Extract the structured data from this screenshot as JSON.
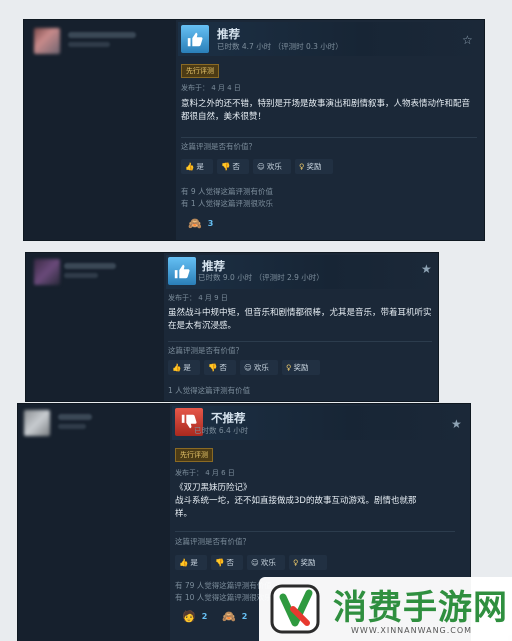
{
  "colors": {
    "card_bg": "#1b2838",
    "accent_blue": "#66c0f4",
    "recommend_icon": "#1a9fff",
    "not_recommend_icon": "#c8372b",
    "early_access_tag": "#e8c66a",
    "watermark_green": "#2f8f3f"
  },
  "reviews": [
    {
      "verdict": "推荐",
      "hours": "已时数 4.7 小时 （评测时 0.3 小时）",
      "tag": "先行评测",
      "date": "发布于： 4 月 4 日",
      "body": "意料之外的还不错，特别是开场是故事演出和剧情叙事，人物表情动作和配音都很自然，美术很赞！",
      "helpful_question": "这篇评测是否有价值？",
      "buttons": {
        "yes": "是",
        "no": "否",
        "funny": "欢乐",
        "award": "奖励"
      },
      "stats": [
        "有 9 人觉得这篇评测有价值",
        "有 1 人觉得这篇评测很欢乐"
      ],
      "award_count": "3"
    },
    {
      "verdict": "推荐",
      "hours": "已时数 9.0 小时 （评测时 2.9 小时）",
      "date": "发布于： 4 月 9 日",
      "body": "虽然战斗中规中矩，但音乐和剧情都很棒，尤其是音乐，带着耳机听实在是太有沉浸感。",
      "helpful_question": "这篇评测是否有价值？",
      "buttons": {
        "yes": "是",
        "no": "否",
        "funny": "欢乐",
        "award": "奖励"
      },
      "stats": [
        "1 人觉得这篇评测有价值"
      ]
    },
    {
      "verdict": "不推荐",
      "hours": "已时数 6.4 小时",
      "tag": "先行评测",
      "date": "发布于： 4 月 6 日",
      "body_title": "《双刀黑妹历险记》",
      "body": "战斗系统一坨，还不如直接做成3D的故事互动游戏。剧情也就那样。",
      "helpful_question": "这篇评测是否有价值？",
      "buttons": {
        "yes": "是",
        "no": "否",
        "funny": "欢乐",
        "award": "奖励"
      },
      "stats": [
        "有 79 人觉得这篇评测有价值",
        "有 10 人觉得这篇评测很欢乐"
      ],
      "award_count_a": "2",
      "award_count_b": "2"
    }
  ],
  "watermark": {
    "title": "消费手游网",
    "url": "WWW.XINNANWANG.COM"
  }
}
